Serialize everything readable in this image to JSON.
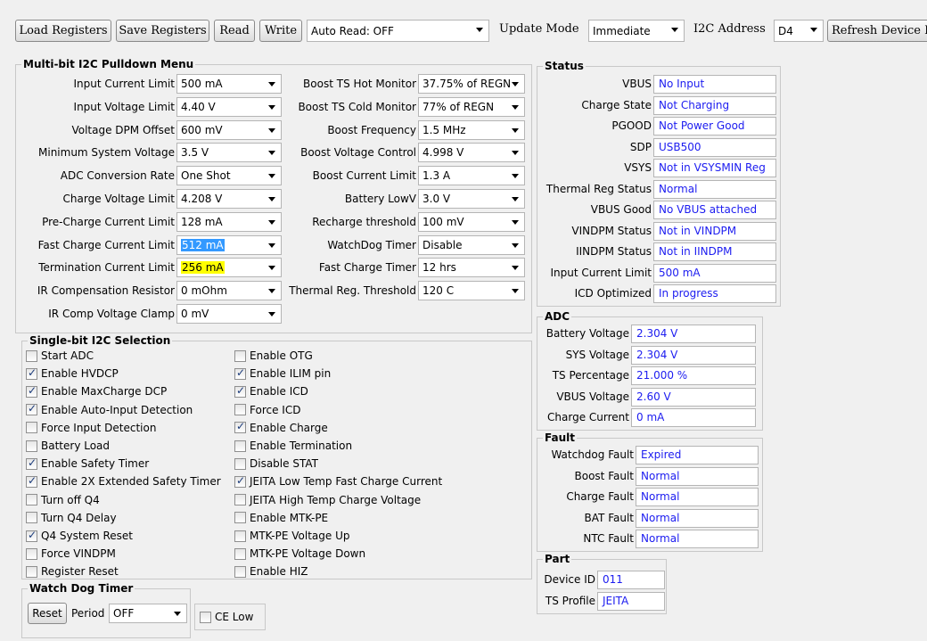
{
  "toolbar": {
    "load": "Load Registers",
    "save": "Save Registers",
    "read": "Read",
    "write": "Write",
    "auto_read": "Auto Read: OFF",
    "update_mode_label": "Update Mode",
    "update_mode_value": "Immediate",
    "i2c_address_label": "I2C Address",
    "i2c_address_value": "D4",
    "refresh": "Refresh Device ID"
  },
  "multibit": {
    "title": "Multi-bit I2C Pulldown Menu",
    "left": [
      {
        "label": "Input Current Limit",
        "value": "500 mA"
      },
      {
        "label": "Input Voltage Limit",
        "value": "4.40 V"
      },
      {
        "label": "Voltage DPM Offset",
        "value": "600 mV"
      },
      {
        "label": "Minimum System Voltage",
        "value": "3.5 V"
      },
      {
        "label": "ADC Conversion Rate",
        "value": "One Shot"
      },
      {
        "label": "Charge Voltage Limit",
        "value": "4.208 V"
      },
      {
        "label": "Pre-Charge Current Limit",
        "value": "128 mA"
      },
      {
        "label": "Fast Charge Current Limit",
        "value": "512 mA"
      },
      {
        "label": "Termination Current Limit",
        "value": "256 mA"
      },
      {
        "label": "IR Compensation Resistor",
        "value": "0 mOhm"
      },
      {
        "label": "IR Comp Voltage Clamp",
        "value": "0 mV"
      }
    ],
    "right": [
      {
        "label": "Boost TS Hot Monitor",
        "value": "37.75% of REGN"
      },
      {
        "label": "Boost TS Cold Monitor",
        "value": "77% of REGN"
      },
      {
        "label": "Boost Frequency",
        "value": "1.5 MHz"
      },
      {
        "label": "Boost Voltage Control",
        "value": "4.998 V"
      },
      {
        "label": "Boost Current Limit",
        "value": "1.3 A"
      },
      {
        "label": "Battery LowV",
        "value": "3.0 V"
      },
      {
        "label": "Recharge threshold",
        "value": "100 mV"
      },
      {
        "label": "WatchDog Timer",
        "value": "Disable"
      },
      {
        "label": "Fast Charge Timer",
        "value": "12 hrs"
      },
      {
        "label": "Thermal Reg. Threshold",
        "value": "120 C"
      }
    ]
  },
  "singlebit": {
    "title": "Single-bit I2C Selection",
    "left": [
      {
        "label": "Start ADC",
        "checked": false
      },
      {
        "label": "Enable HVDCP",
        "checked": true
      },
      {
        "label": "Enable MaxCharge DCP",
        "checked": true
      },
      {
        "label": "Enable Auto-Input Detection",
        "checked": true
      },
      {
        "label": "Force Input Detection",
        "checked": false
      },
      {
        "label": "Battery Load",
        "checked": false
      },
      {
        "label": "Enable Safety Timer",
        "checked": true
      },
      {
        "label": "Enable 2X Extended Safety Timer",
        "checked": true
      },
      {
        "label": "Turn off Q4",
        "checked": false
      },
      {
        "label": "Turn Q4 Delay",
        "checked": false
      },
      {
        "label": "Q4 System Reset",
        "checked": true
      },
      {
        "label": "Force VINDPM",
        "checked": false
      },
      {
        "label": "Register Reset",
        "checked": false
      }
    ],
    "right": [
      {
        "label": "Enable OTG",
        "checked": false
      },
      {
        "label": "Enable ILIM pin",
        "checked": true
      },
      {
        "label": "Enable ICD",
        "checked": true
      },
      {
        "label": "Force ICD",
        "checked": false
      },
      {
        "label": "Enable Charge",
        "checked": true
      },
      {
        "label": "Enable Termination",
        "checked": false
      },
      {
        "label": "Disable STAT",
        "checked": false
      },
      {
        "label": "JEITA Low Temp Fast Charge Current",
        "checked": true
      },
      {
        "label": "JEITA High Temp Charge Voltage",
        "checked": false
      },
      {
        "label": "Enable MTK-PE",
        "checked": false
      },
      {
        "label": "MTK-PE Voltage Up",
        "checked": false
      },
      {
        "label": "MTK-PE Voltage Down",
        "checked": false
      },
      {
        "label": "Enable HIZ",
        "checked": false
      }
    ]
  },
  "watchdog": {
    "title": "Watch Dog Timer",
    "reset": "Reset",
    "period_label": "Period",
    "period_value": "OFF"
  },
  "ce_low": {
    "label": "CE Low",
    "checked": false
  },
  "status": {
    "title": "Status",
    "rows": [
      {
        "label": "VBUS",
        "value": "No Input"
      },
      {
        "label": "Charge State",
        "value": "Not Charging"
      },
      {
        "label": "PGOOD",
        "value": "Not Power Good"
      },
      {
        "label": "SDP",
        "value": "USB500"
      },
      {
        "label": "VSYS",
        "value": "Not in VSYSMIN Reg"
      },
      {
        "label": "Thermal Reg Status",
        "value": "Normal"
      },
      {
        "label": "VBUS Good",
        "value": "No VBUS attached"
      },
      {
        "label": "VINDPM Status",
        "value": "Not in VINDPM"
      },
      {
        "label": "IINDPM Status",
        "value": "Not in IINDPM"
      },
      {
        "label": "Input Current Limit",
        "value": "500 mA"
      },
      {
        "label": "ICD Optimized",
        "value": "In progress"
      }
    ]
  },
  "adc": {
    "title": "ADC",
    "rows": [
      {
        "label": "Battery Voltage",
        "value": "2.304 V"
      },
      {
        "label": "SYS Voltage",
        "value": "2.304 V"
      },
      {
        "label": "TS Percentage",
        "value": "21.000 %"
      },
      {
        "label": "VBUS Voltage",
        "value": "2.60 V"
      },
      {
        "label": "Charge Current",
        "value": "0 mA"
      }
    ]
  },
  "fault": {
    "title": "Fault",
    "rows": [
      {
        "label": "Watchdog Fault",
        "value": "Expired"
      },
      {
        "label": "Boost Fault",
        "value": "Normal"
      },
      {
        "label": "Charge Fault",
        "value": "Normal"
      },
      {
        "label": "BAT Fault",
        "value": "Normal"
      },
      {
        "label": "NTC Fault",
        "value": "Normal"
      }
    ]
  },
  "part": {
    "title": "Part",
    "rows": [
      {
        "label": "Device ID",
        "value": "011"
      },
      {
        "label": "TS Profile",
        "value": "JEITA"
      }
    ]
  }
}
